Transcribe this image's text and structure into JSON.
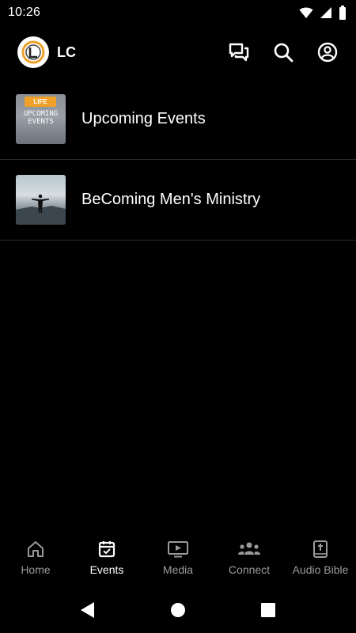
{
  "status_bar": {
    "time": "10:26"
  },
  "app_bar": {
    "title": "LC",
    "icons": [
      "chat-icon",
      "search-icon",
      "account-icon"
    ]
  },
  "list": {
    "items": [
      {
        "label": "Upcoming Events",
        "thumb_badge": "LIFE",
        "thumb_text_line1": "UPCOMING",
        "thumb_text_line2": "EVENTS"
      },
      {
        "label": "BeComing Men's Ministry"
      }
    ]
  },
  "bottom_nav": {
    "items": [
      {
        "label": "Home",
        "icon": "home-icon",
        "active": false
      },
      {
        "label": "Events",
        "icon": "calendar-icon",
        "active": true
      },
      {
        "label": "Media",
        "icon": "media-icon",
        "active": false
      },
      {
        "label": "Connect",
        "icon": "people-icon",
        "active": false
      },
      {
        "label": "Audio Bible",
        "icon": "bible-icon",
        "active": false
      }
    ]
  },
  "colors": {
    "background": "#000000",
    "text": "#ffffff",
    "inactive_nav": "#9a9a9a",
    "divider": "#2a2a2a",
    "logo_accent": "#f0a12a"
  }
}
